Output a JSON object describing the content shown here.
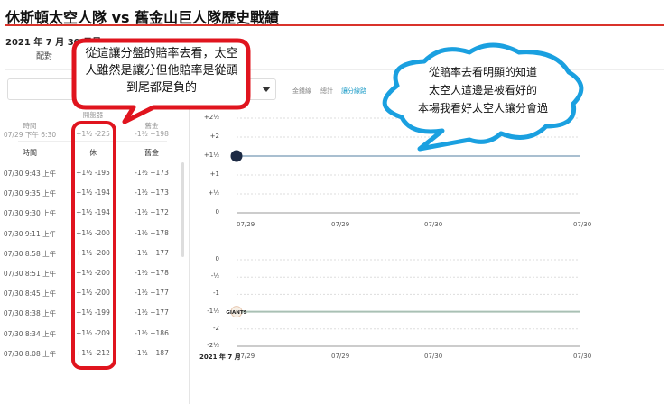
{
  "header": {
    "title": "休斯頓太空人隊 vs 舊金山巨人隊歷史戰績",
    "date": "2021 年 7 月 30 日星",
    "pair_label": "配對"
  },
  "controls": {
    "select_value": "讓",
    "tabs": [
      "金錢線",
      "總計",
      "讓分線路"
    ],
    "active_tab": 2
  },
  "table": {
    "opening_label": "開盤器",
    "opening": {
      "time_label": "時間",
      "time": "07/29 下午 6:30",
      "home": "+1½ -225",
      "away": "-1½ +198"
    },
    "columns": [
      "時間",
      "休",
      "舊金"
    ],
    "rows": [
      [
        "07/30 9:43 上午",
        "+1½ -195",
        "-1½ +173"
      ],
      [
        "07/30 9:35 上午",
        "+1½ -194",
        "-1½ +173"
      ],
      [
        "07/30 9:30 上午",
        "+1½ -194",
        "-1½ +172"
      ],
      [
        "07/30 9:11 上午",
        "+1½ -200",
        "-1½ +178"
      ],
      [
        "07/30 8:58 上午",
        "+1½ -200",
        "-1½ +177"
      ],
      [
        "07/30 8:51 上午",
        "+1½ -200",
        "-1½ +178"
      ],
      [
        "07/30 8:45 上午",
        "+1½ -200",
        "-1½ +177"
      ],
      [
        "07/30 8:38 上午",
        "+1½ -199",
        "-1½ +177"
      ],
      [
        "07/30 8:34 上午",
        "+1½ -209",
        "-1½ +186"
      ],
      [
        "07/30 8:08 上午",
        "+1½ -212",
        "-1½ +187"
      ]
    ]
  },
  "chart_data": [
    {
      "type": "line",
      "series": [
        {
          "name": "休斯頓太空人隊",
          "values": [
            1.5,
            1.5
          ]
        }
      ],
      "yticks": [
        "+2½",
        "+2",
        "+1½",
        "+1",
        "+½",
        "0"
      ],
      "ylim": [
        0,
        2.5
      ],
      "xticks": [
        "07/29",
        "07/29",
        "07/30",
        "07/30"
      ]
    },
    {
      "type": "line",
      "series": [
        {
          "name": "舊金山巨人隊",
          "values": [
            -1.5,
            -1.5
          ]
        }
      ],
      "yticks": [
        "0",
        "-½",
        "-1",
        "-1½",
        "-2",
        "-2½"
      ],
      "ylim": [
        -2.5,
        0
      ],
      "xticks": [
        "07/29",
        "07/29",
        "07/30",
        "07/30"
      ],
      "xlabel_prefix": "2021 年 7 月"
    }
  ],
  "giants_logo_text": "GIANTS",
  "colors": {
    "accent": "#d9332b",
    "link": "#1a9bc7",
    "annotation_red": "#e0141e",
    "annotation_blue": "#1aa0e0"
  },
  "annotations": {
    "red": [
      "從這讓分盤的賠率去看，太空",
      "人雖然是讓分但他賠率是從頭",
      "到尾都是負的"
    ],
    "blue": [
      "從賠率去看明顯的知道",
      "太空人這邊是被看好的",
      "本場我看好太空人讓分會過"
    ]
  }
}
